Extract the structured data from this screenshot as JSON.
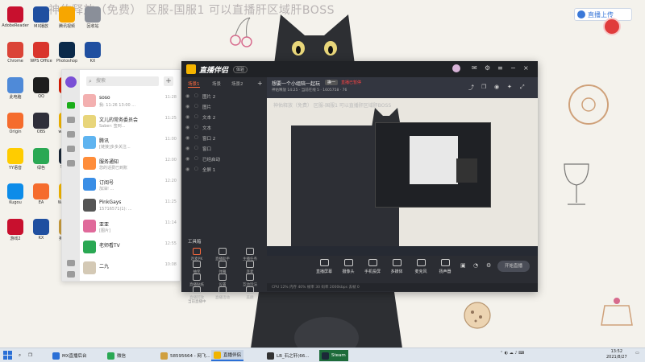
{
  "banner": "神佑释放（免费）  区服-国服1 可以直播肝区域肝BOSS",
  "live_badge": "直播上传",
  "desktop_icons": [
    {
      "label": "AdobeReader",
      "color": "#c8102e"
    },
    {
      "label": "MX播放",
      "color": "#1f4fa0"
    },
    {
      "label": "腾讯视频",
      "color": "#f7a600"
    },
    {
      "label": "回收站",
      "color": "#8a8f99"
    },
    {
      "label": "Chrome",
      "color": "#db4437"
    },
    {
      "label": "WPS Office",
      "color": "#d9352d"
    },
    {
      "label": "Photoshop",
      "color": "#0b2a4a"
    },
    {
      "label": "KX",
      "color": "#1f4fa0"
    },
    {
      "label": "此电脑",
      "color": "#4f8ad8"
    },
    {
      "label": "QQ",
      "color": "#1d1d1d"
    },
    {
      "label": "网易云",
      "color": "#d81e06"
    },
    {
      "label": "爱奇艺",
      "color": "#00be06"
    },
    {
      "label": "Origin",
      "color": "#f56c2d"
    },
    {
      "label": "OBS",
      "color": "#2f2f3a"
    },
    {
      "label": "wegame",
      "color": "#f0b400"
    },
    {
      "label": "网易",
      "color": "#d81e06"
    },
    {
      "label": "YY语音",
      "color": "#ffcc00"
    },
    {
      "label": "绿色",
      "color": "#2aa853"
    },
    {
      "label": "Steam",
      "color": "#1b2838"
    },
    {
      "label": "游戏",
      "color": "#21a366"
    },
    {
      "label": "Kugou",
      "color": "#0c8ce9"
    },
    {
      "label": "EA",
      "color": "#f56c2d"
    },
    {
      "label": "WeGame",
      "color": "#f0b400"
    },
    {
      "label": "应用",
      "color": "#2d7be5"
    },
    {
      "label": "游戏2",
      "color": "#c8102e"
    },
    {
      "label": "KX",
      "color": "#1f4fa0"
    },
    {
      "label": "英雄联盟",
      "color": "#c89b3c"
    },
    {
      "label": "Dota",
      "color": "#b33"
    }
  ],
  "qq": {
    "search_placeholder": "搜索",
    "chats": [
      {
        "name": "soso",
        "preview": "我: 11:26 13:00 ...",
        "time": "11:28",
        "color": "#f3b0b0"
      },
      {
        "name": "文儿的常务委员会",
        "preview": "Saber: 签到...",
        "time": "11:25",
        "color": "#e8d57a"
      },
      {
        "name": "腾讯",
        "preview": "[链接]多多关注...",
        "time": "11:00",
        "color": "#5fb4f0"
      },
      {
        "name": "服务通知",
        "preview": "您的话费已到账",
        "time": "12:00",
        "color": "#ff8d3a"
      },
      {
        "name": "订阅号",
        "preview": "加油! ...",
        "time": "12:20",
        "color": "#3a8ee6"
      },
      {
        "name": "PinkGays",
        "preview": "15716571(1): ...",
        "time": "11:25",
        "color": "#555"
      },
      {
        "name": "亚亚",
        "preview": "[图片]",
        "time": "11:14",
        "color": "#e06a9b"
      },
      {
        "name": "老师看TV",
        "preview": "",
        "time": "12:55",
        "color": "#2aa853"
      },
      {
        "name": "二九",
        "preview": "",
        "time": "10:08",
        "color": "#d4c9b5"
      }
    ]
  },
  "stream_app": {
    "name": "直播伴侣",
    "version": "体验",
    "tabs": [
      "场景1",
      "场景",
      "场景2"
    ],
    "scenes": [
      "图片 2",
      "图片",
      "文本 2",
      "文本",
      "窗口 2",
      "窗口",
      "已经启动",
      "全屏 1"
    ],
    "toolbox_label": "工具箱",
    "tools": [
      "连麦PK",
      "直播助手",
      "主播任务",
      "抽奖",
      "弹幕",
      "连麦",
      "直播贴纸",
      "设置",
      "互动玩法",
      "直播回放",
      "直播活动",
      "美颜"
    ],
    "status": "当前直播中"
  },
  "room": {
    "title": "想要一个小组陪一起玩",
    "tag": "换一",
    "warning": "直播已暂停",
    "info": "神佑释放 14:25 · 当前在线 5 · 1605758 · 76"
  },
  "preview_banner": "神佑释放（免费）  区服-国服1 可以直播肝区域肝BOSS",
  "bottom_controls": [
    "直播屏幕",
    "摄像头",
    "手机投屏",
    "多媒体",
    "麦克风",
    "扬声器"
  ],
  "go_live": "开始直播",
  "stats": "CPU 12%  内存 40%  帧率 30  码率 2000kbps  丢帧 0",
  "taskbar": {
    "items": [
      {
        "label": "MX直播后台",
        "color": "#2a6fd6"
      },
      {
        "label": "微信",
        "color": "#2aa853"
      },
      {
        "label": "58595664 - 网飞...",
        "color": "#d0a040"
      },
      {
        "label": "直播伴侣",
        "color": "#f0b400"
      },
      {
        "label": "LB_石之轩(66...",
        "color": "#333"
      },
      {
        "label": "Steam",
        "color": "#1b2838"
      }
    ],
    "time": "13:52",
    "date": "2021/8/27"
  }
}
